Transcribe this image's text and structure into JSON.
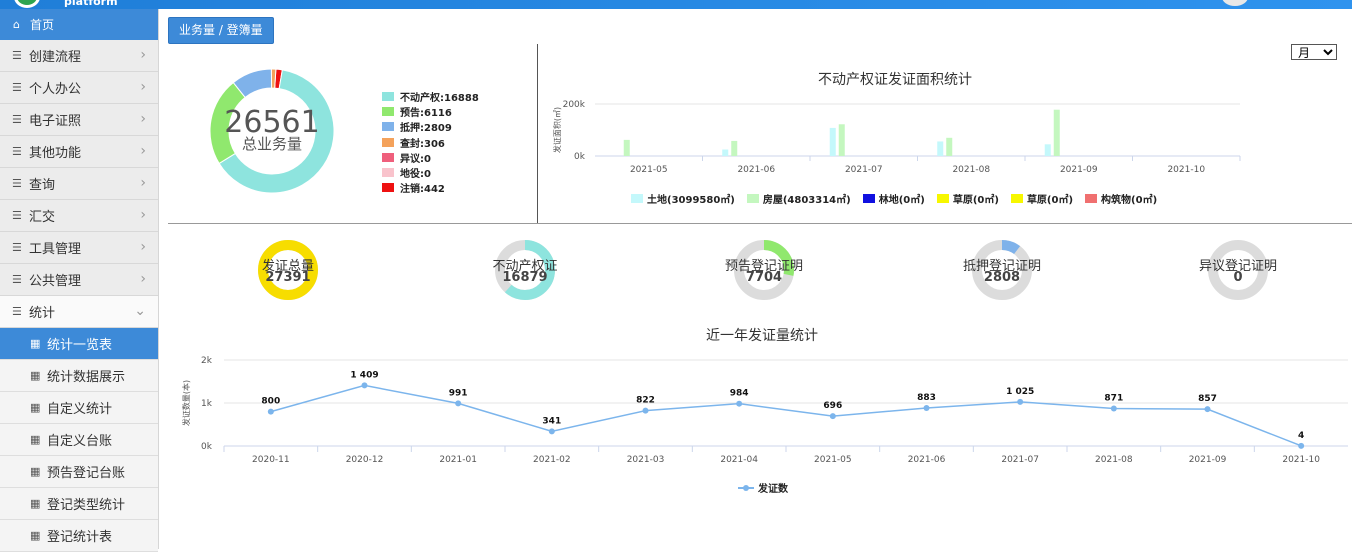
{
  "header": {
    "platform_text": "platform"
  },
  "sidebar": {
    "home": "首页",
    "items": [
      {
        "label": "创建流程"
      },
      {
        "label": "个人办公"
      },
      {
        "label": "电子证照"
      },
      {
        "label": "其他功能"
      },
      {
        "label": "查询"
      },
      {
        "label": "汇交"
      },
      {
        "label": "工具管理"
      },
      {
        "label": "公共管理"
      },
      {
        "label": "统计"
      }
    ],
    "sub_items": [
      {
        "label": "统计一览表"
      },
      {
        "label": "统计数据展示"
      },
      {
        "label": "自定义统计"
      },
      {
        "label": "自定义台账"
      },
      {
        "label": "预告登记台账"
      },
      {
        "label": "登记类型统计"
      },
      {
        "label": "登记统计表"
      }
    ]
  },
  "main": {
    "tab_label": "业务量 / 登簿量",
    "period_select": {
      "value": "月",
      "options": [
        "月"
      ]
    },
    "total": {
      "value": "26561",
      "label": "总业务量"
    },
    "colors": {
      "accent": "#3d8ad8",
      "teal": "#8ee4de",
      "green": "#90e86e",
      "blue": "#7fb2ea",
      "orange": "#f4a25b",
      "pink": "#ef5f7c",
      "lightpink": "#f9c3cc",
      "red": "#ee1111",
      "yellow": "#f7dd00",
      "grey": "#dcdcdc"
    },
    "business_legend": [
      {
        "label": "不动产权:16888",
        "value": 16888,
        "color": "#8ee4de"
      },
      {
        "label": "预告:6116",
        "value": 6116,
        "color": "#90e86e"
      },
      {
        "label": "抵押:2809",
        "value": 2809,
        "color": "#7fb2ea"
      },
      {
        "label": "查封:306",
        "value": 306,
        "color": "#f4a25b"
      },
      {
        "label": "异议:0",
        "value": 0,
        "color": "#ef5f7c"
      },
      {
        "label": "地役:0",
        "value": 0,
        "color": "#f9c3cc"
      },
      {
        "label": "注销:442",
        "value": 442,
        "color": "#ee1111"
      }
    ],
    "gauges": [
      {
        "label": "发证总量",
        "value": "27391",
        "fraction": 1.0,
        "color": "#f7dd00"
      },
      {
        "label": "不动产权证",
        "value": "16879",
        "fraction": 0.616,
        "color": "#8ee4de"
      },
      {
        "label": "预告登记证明",
        "value": "7704",
        "fraction": 0.281,
        "color": "#90e86e"
      },
      {
        "label": "抵押登记证明",
        "value": "2808",
        "fraction": 0.103,
        "color": "#7fb2ea"
      },
      {
        "label": "异议登记证明",
        "value": "0",
        "fraction": 0.0,
        "color": "#ef5f7c"
      }
    ]
  },
  "chart_data": [
    {
      "type": "bar",
      "title": "不动产权证发证面积统计",
      "ylabel": "发证面积(㎡)",
      "yticks": [
        "0k",
        "200k"
      ],
      "ylim": [
        0,
        200000
      ],
      "categories": [
        "2021-05",
        "2021-06",
        "2021-07",
        "2021-08",
        "2021-09",
        "2021-10"
      ],
      "legend_position": "bottom",
      "series": [
        {
          "name": "土地(3099580㎡)",
          "color": "#c4f8fb",
          "values": [
            0,
            25000,
            108000,
            56000,
            45000,
            0
          ]
        },
        {
          "name": "房屋(4803314㎡)",
          "color": "#c4f7bf",
          "values": [
            62000,
            58000,
            122000,
            70000,
            178000,
            0
          ]
        },
        {
          "name": "林地(0㎡)",
          "color": "#1010e0",
          "values": [
            0,
            0,
            0,
            0,
            0,
            0
          ]
        },
        {
          "name": "草原(0㎡)",
          "color": "#f7f700",
          "values": [
            0,
            0,
            0,
            0,
            0,
            0
          ]
        },
        {
          "name": "草原(0㎡)",
          "color": "#f7f700",
          "values": [
            0,
            0,
            0,
            0,
            0,
            0
          ]
        },
        {
          "name": "构筑物(0㎡)",
          "color": "#f07070",
          "values": [
            0,
            0,
            0,
            0,
            0,
            0
          ]
        }
      ]
    },
    {
      "type": "line",
      "title": "近一年发证量统计",
      "ylabel": "发证数量(本)",
      "yticks": [
        "0k",
        "1k",
        "2k"
      ],
      "ylim": [
        0,
        2000
      ],
      "categories": [
        "2020-11",
        "2020-12",
        "2021-01",
        "2021-02",
        "2021-03",
        "2021-04",
        "2021-05",
        "2021-06",
        "2021-07",
        "2021-08",
        "2021-09",
        "2021-10"
      ],
      "legend_position": "bottom",
      "series": [
        {
          "name": "发证数",
          "color": "#7cb5ec",
          "values": [
            800,
            1409,
            991,
            341,
            822,
            984,
            696,
            883,
            1025,
            871,
            857,
            4
          ],
          "labels": [
            "800",
            "1 409",
            "991",
            "341",
            "822",
            "984",
            "696",
            "883",
            "1 025",
            "871",
            "857",
            "4"
          ]
        }
      ]
    }
  ]
}
